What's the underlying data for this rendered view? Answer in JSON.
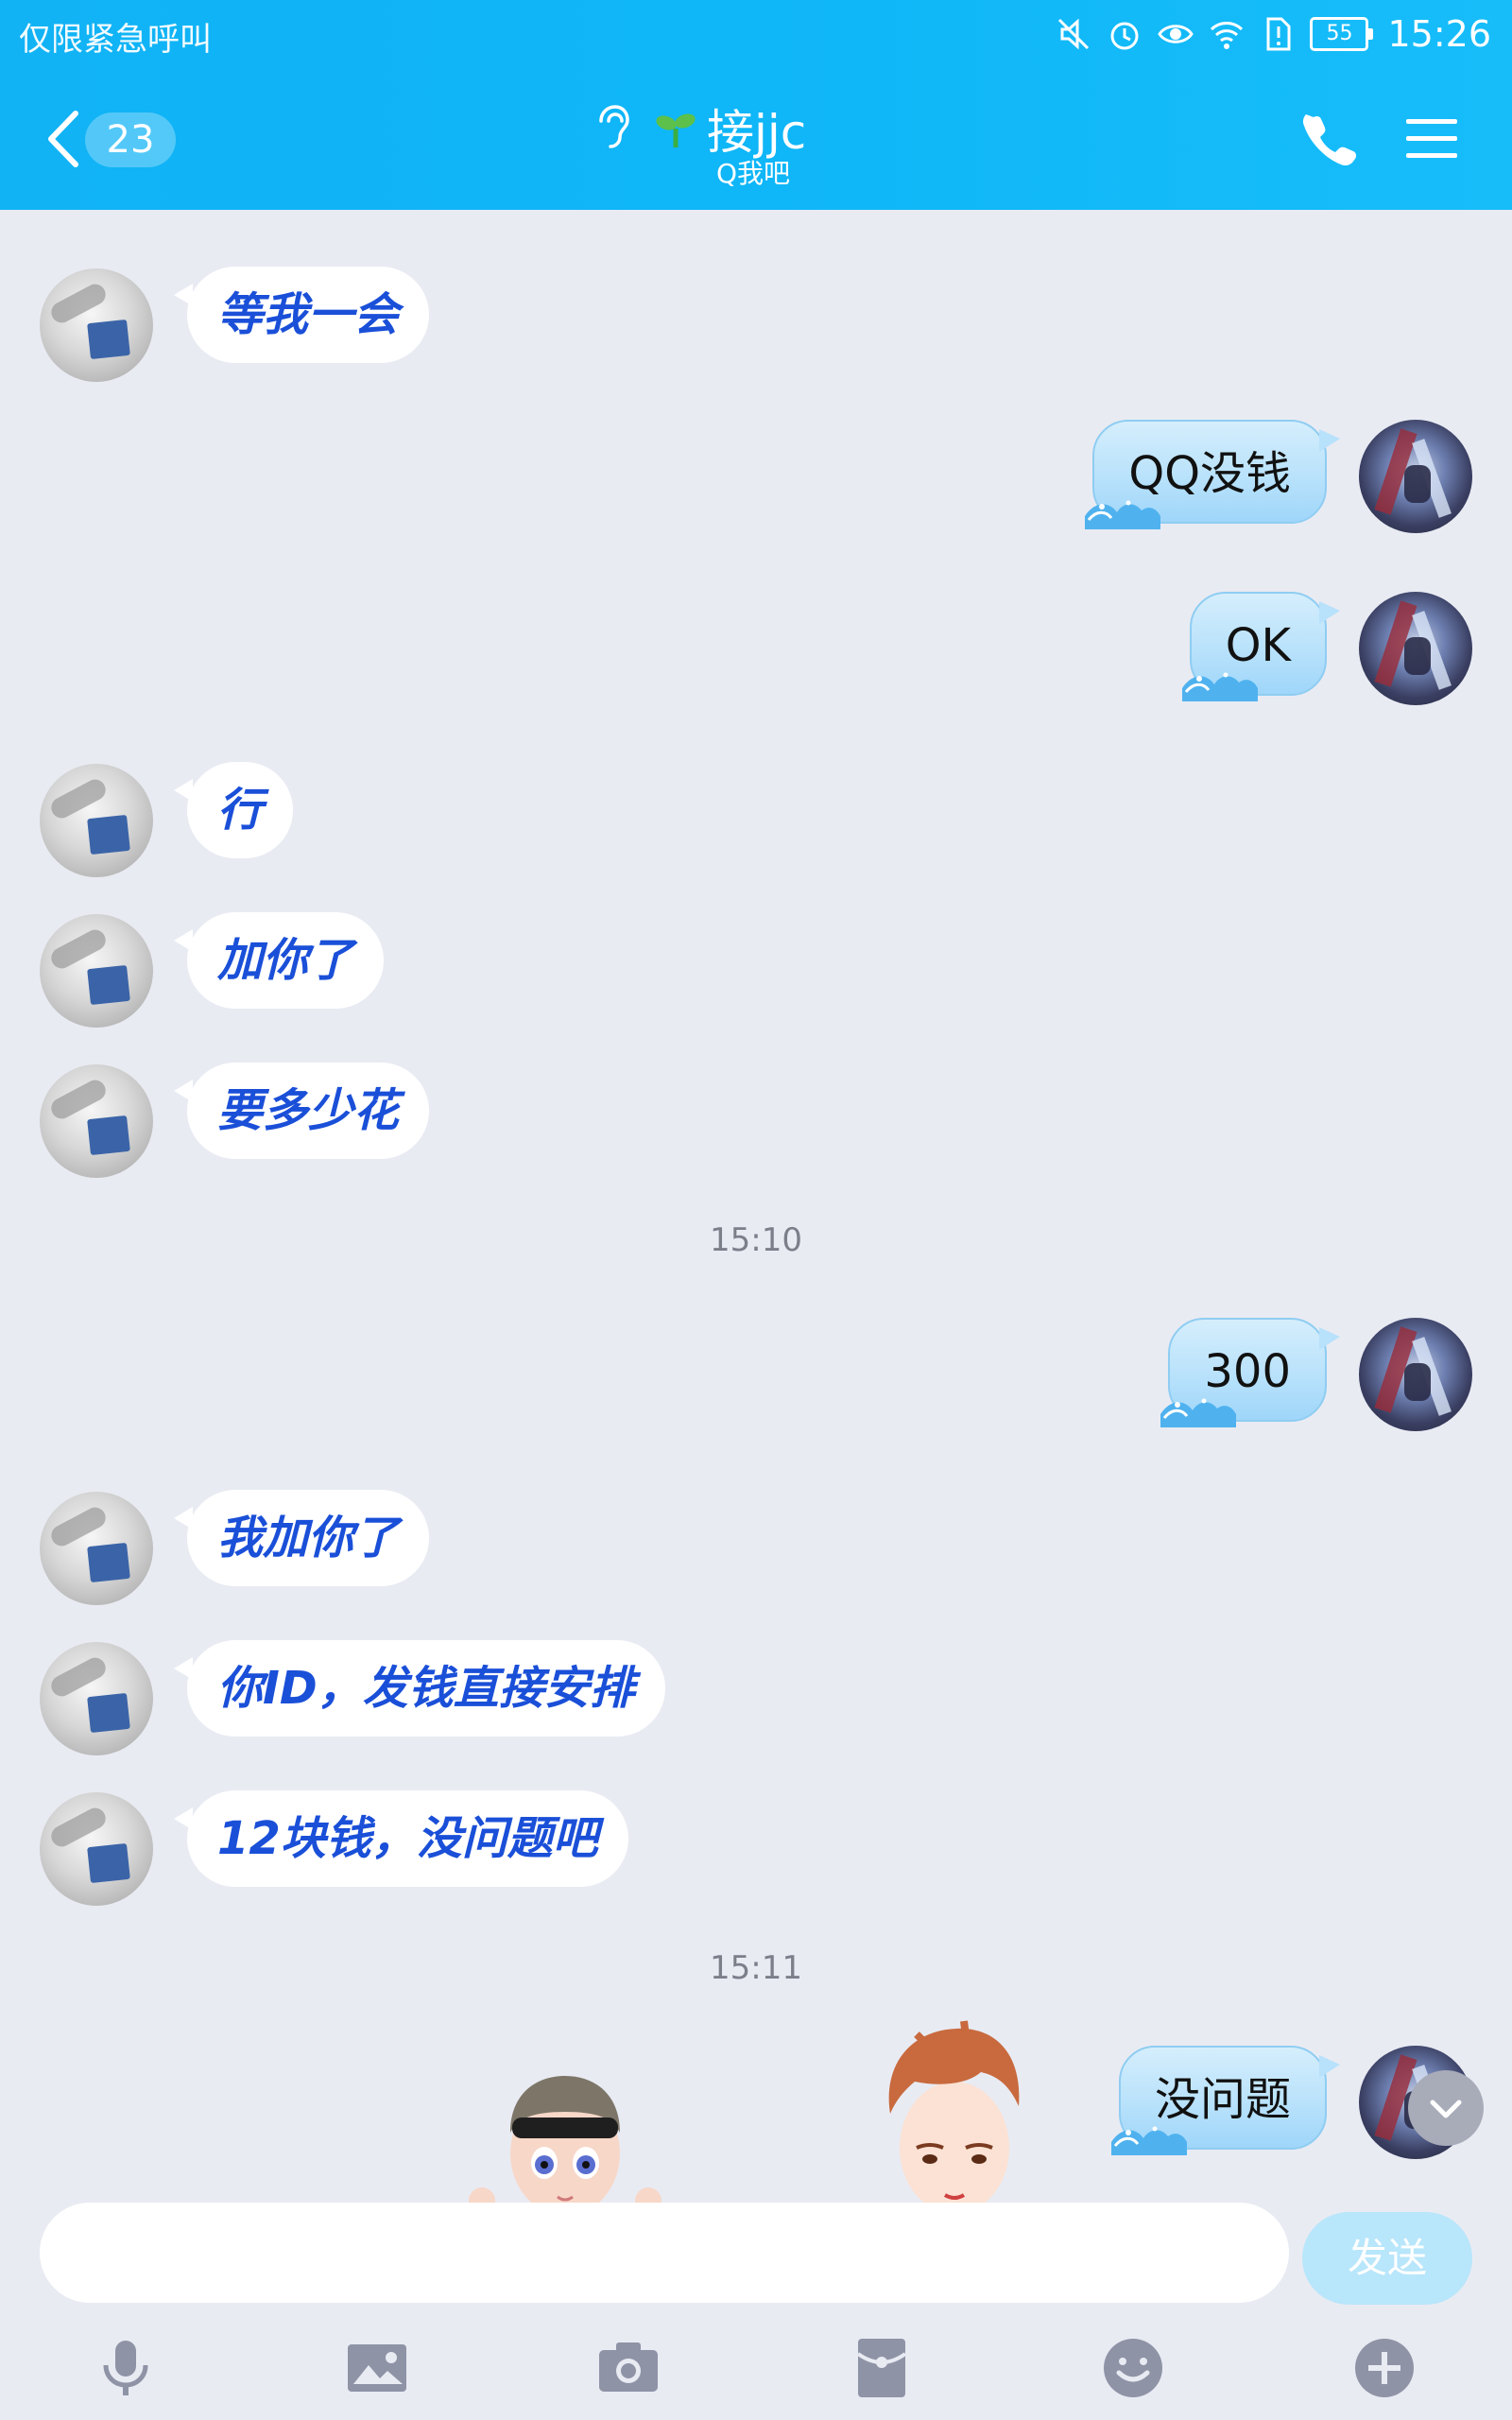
{
  "status_bar": {
    "carrier": "仅限紧急呼叫",
    "battery": "55",
    "time": "15:26"
  },
  "header": {
    "unread_count": "23",
    "contact_name": "接jjc",
    "contact_status": "Q我吧",
    "icons": [
      "back-icon",
      "ear-icon",
      "sprout-icon",
      "phone-icon",
      "menu-icon"
    ]
  },
  "messages": {
    "m1": "等我一会",
    "m2": "QQ没钱",
    "m3": "OK",
    "m4": "行",
    "m5": "加你了",
    "m6": "要多少花",
    "t1": "15:10",
    "m7": "300",
    "m8": "我加你了",
    "m9": "你ID，发钱直接安排",
    "m10": "12块钱，没问题吧",
    "t2": "15:11",
    "m11": "没问题"
  },
  "input": {
    "placeholder": "",
    "send_label": "发送"
  },
  "toolbar": {
    "items": [
      "mic-icon",
      "image-icon",
      "camera-icon",
      "red-packet-icon",
      "emoji-icon",
      "plus-icon"
    ]
  },
  "colors": {
    "header": "#11b3f5",
    "incoming_text": "#1a4fd8",
    "background": "#e9ebf3",
    "send_button": "#b8e6fb"
  }
}
